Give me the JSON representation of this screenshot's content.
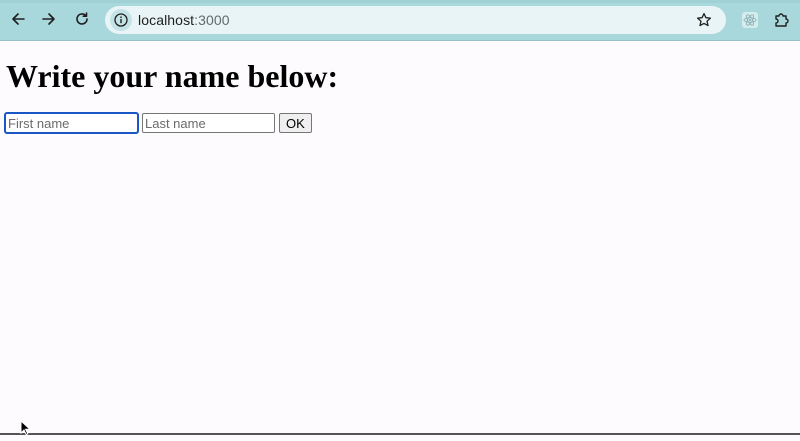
{
  "browser": {
    "url_host": "localhost",
    "url_port": ":3000",
    "icons": {
      "back": "back-arrow-icon",
      "forward": "forward-arrow-icon",
      "reload": "reload-icon",
      "site_info": "info-icon",
      "bookmark": "star-icon",
      "react_extension": "react-icon",
      "extensions": "puzzle-icon"
    },
    "colors": {
      "toolbar": "#a9d8dc",
      "omnibox": "#e8f4f5"
    }
  },
  "page": {
    "heading": "Write your name below:",
    "first_name": {
      "placeholder": "First name",
      "value": ""
    },
    "last_name": {
      "placeholder": "Last name",
      "value": ""
    },
    "ok_label": "OK",
    "focus_color": "#1a56c7"
  }
}
